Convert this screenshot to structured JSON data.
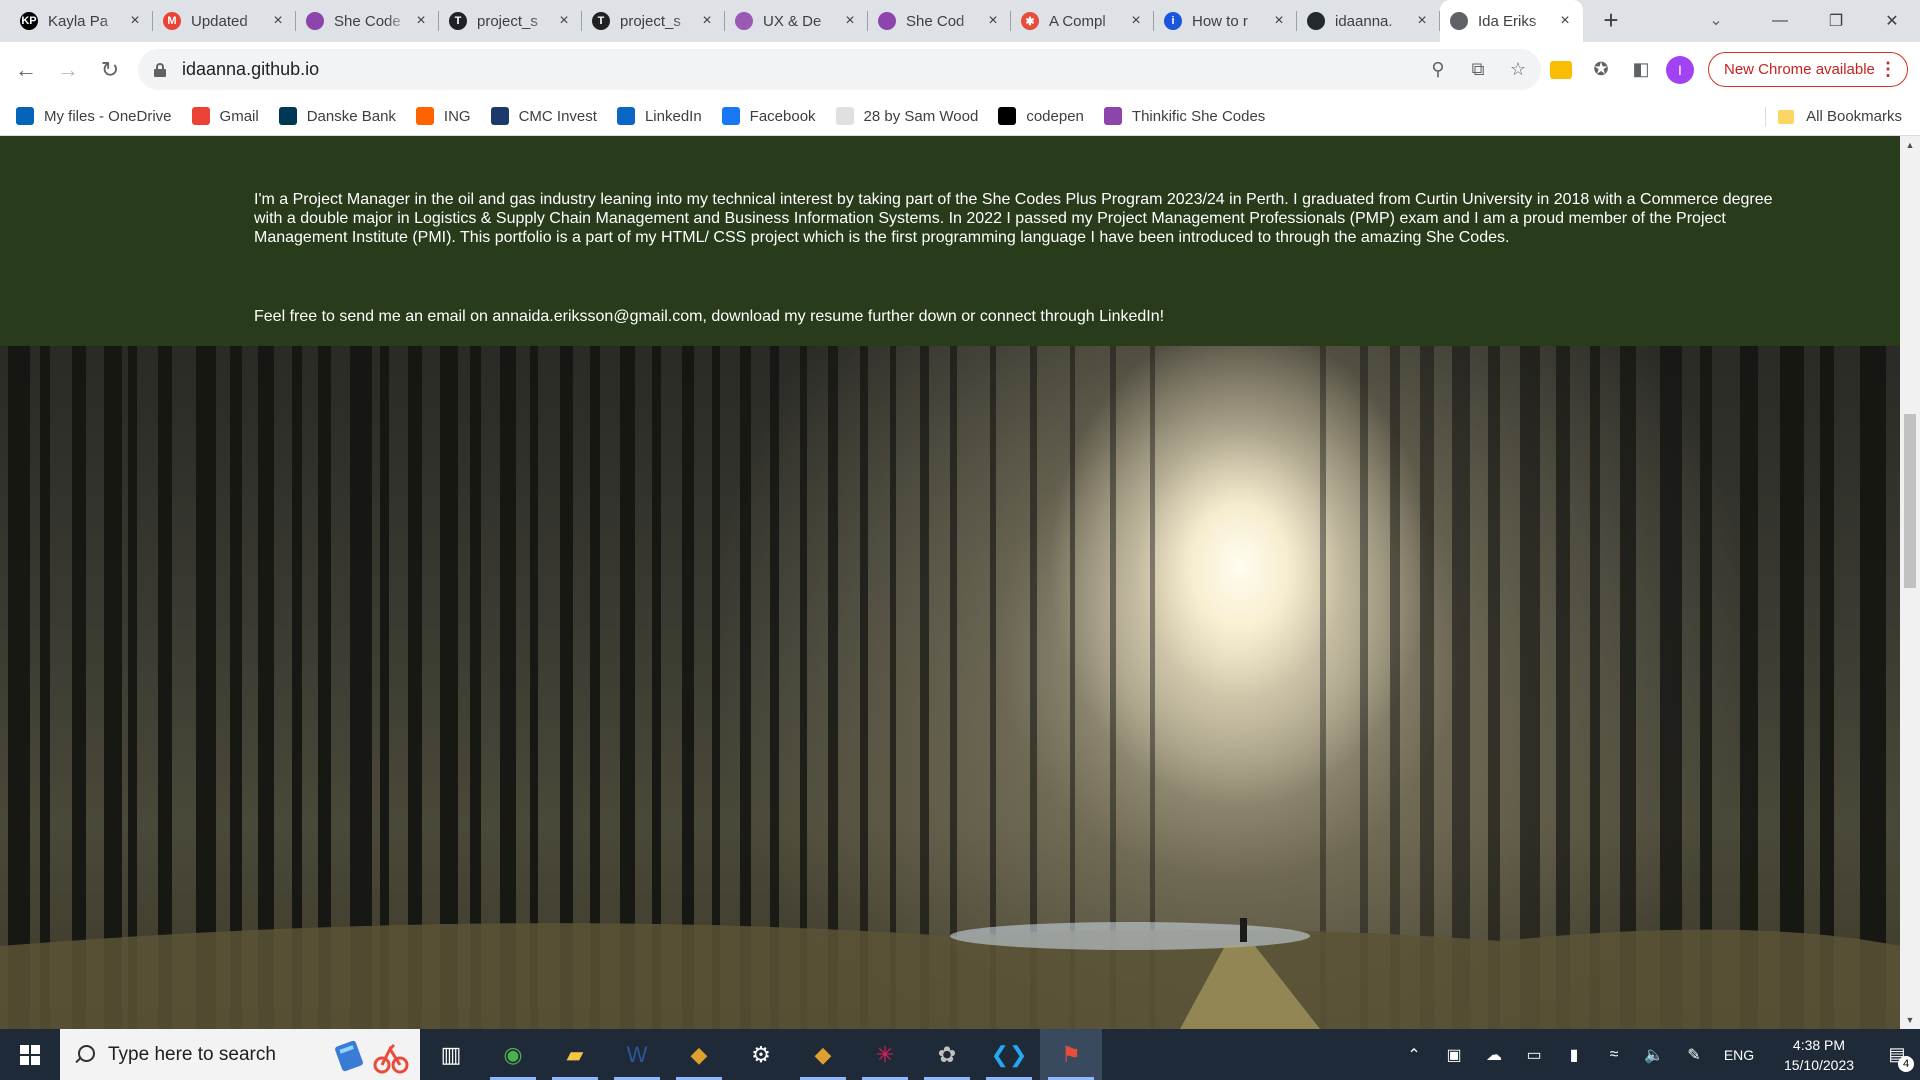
{
  "browser": {
    "tabs": [
      {
        "title": "Kayla Pa",
        "icon": "kp-icon",
        "color": "#000000",
        "glyph": "KP"
      },
      {
        "title": "Updated",
        "icon": "gmail-icon",
        "color": "#ea4335",
        "glyph": "M"
      },
      {
        "title": "She Code",
        "icon": "she-codes-icon",
        "color": "#8e44ad",
        "glyph": ""
      },
      {
        "title": "project_s",
        "icon": "project-icon",
        "color": "#202124",
        "glyph": "T"
      },
      {
        "title": "project_s",
        "icon": "project-icon",
        "color": "#202124",
        "glyph": "T"
      },
      {
        "title": "UX & De",
        "icon": "ux-icon",
        "color": "#9b59b6",
        "glyph": ""
      },
      {
        "title": "She Cod",
        "icon": "she-codes-icon",
        "color": "#8e44ad",
        "glyph": ""
      },
      {
        "title": "A Compl",
        "icon": "asterisk-icon",
        "color": "#e74c3c",
        "glyph": "✱"
      },
      {
        "title": "How to r",
        "icon": "info-icon",
        "color": "#1a56db",
        "glyph": "i"
      },
      {
        "title": "idaanna.",
        "icon": "github-icon",
        "color": "#24292e",
        "glyph": ""
      },
      {
        "title": "Ida Eriks",
        "icon": "globe-icon",
        "color": "#5f6368",
        "glyph": ""
      }
    ],
    "new_tab_label": "+",
    "url": "idaanna.github.io",
    "update_label": "New Chrome available",
    "profile_initial": "I",
    "bookmarks": [
      {
        "label": "My files - OneDrive",
        "icon": "onedrive-icon",
        "color": "#0364b8"
      },
      {
        "label": "Gmail",
        "icon": "gmail-icon",
        "color": "#ea4335"
      },
      {
        "label": "Danske Bank",
        "icon": "danske-bank-icon",
        "color": "#003755"
      },
      {
        "label": "ING",
        "icon": "ing-icon",
        "color": "#ff6200"
      },
      {
        "label": "CMC Invest",
        "icon": "cmc-icon",
        "color": "#1b3a6b"
      },
      {
        "label": "LinkedIn",
        "icon": "linkedin-icon",
        "color": "#0a66c2"
      },
      {
        "label": "Facebook",
        "icon": "facebook-icon",
        "color": "#1877f2"
      },
      {
        "label": "28 by Sam Wood",
        "icon": "28-icon",
        "color": "#e0e0e0"
      },
      {
        "label": "codepen",
        "icon": "codepen-icon",
        "color": "#000000"
      },
      {
        "label": "Thinkific She Codes",
        "icon": "she-codes-icon",
        "color": "#8e44ad"
      }
    ],
    "all_bookmarks_label": "All Bookmarks"
  },
  "page": {
    "about_paragraph": "I'm a Project Manager in the oil and gas industry leaning into my technical interest by taking part of the She Codes Plus Program 2023/24 in Perth. I graduated from Curtin University in 2018 with a Commerce degree with a double major in Logistics & Supply Chain Management and Business Information Systems. In 2022 I passed my Project Management Professionals (PMP) exam and I am a proud member of the Project Management Institute (PMI). This portfolio is a part of my HTML/ CSS project which is the first programming language I have been introduced to through the amazing She Codes.",
    "contact_paragraph": "Feel free to send me an email on annaida.eriksson@gmail.com, download my resume further down or connect through LinkedIn!",
    "about_bg": "#283c1b",
    "hero_image": "forest-sunlight-image"
  },
  "taskbar": {
    "search_placeholder": "Type here to search",
    "apps": [
      "task-view-icon",
      "chrome-icon",
      "file-explorer-icon",
      "word-icon",
      "git-icon",
      "settings-icon",
      "git-icon",
      "slack-icon",
      "paint-icon",
      "vscode-icon",
      "teams-icon"
    ],
    "language": "ENG",
    "time": "4:38 PM",
    "date": "15/10/2023",
    "notification_count": "4"
  }
}
